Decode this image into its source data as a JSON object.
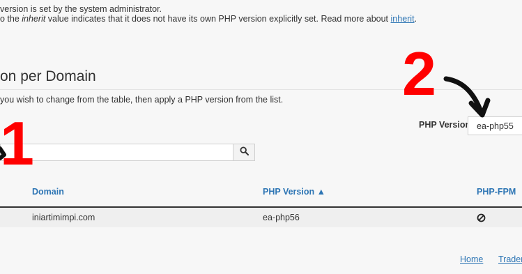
{
  "info": {
    "line1": "version is set by the system administrator.",
    "line2_prefix": "o the ",
    "line2_em": "inherit",
    "line2_middle": " value indicates that it does not have its own PHP version explicitly set. Read more about ",
    "line2_link": "inherit",
    "line2_suffix": "."
  },
  "section": {
    "title": "on per Domain",
    "description": "you wish to change from the table, then apply a PHP version from the list."
  },
  "search": {
    "placeholder": "",
    "value": "",
    "button_icon": "search-icon"
  },
  "php_version": {
    "label": "PHP Version",
    "selected": "ea-php55"
  },
  "table": {
    "columns": [
      "Domain",
      "PHP Version ▲",
      "PHP-FPM"
    ],
    "rows": [
      {
        "domain": "iniartimimpi.com",
        "php_version": "ea-php56",
        "php_fpm_icon": "disabled-icon"
      }
    ]
  },
  "annotations": {
    "marker_1": "1",
    "marker_2": "2",
    "marker_color": "#ff0000"
  },
  "footer": {
    "links": [
      "Home",
      "Trader"
    ]
  },
  "colors": {
    "link": "#2d75b4",
    "background": "#f7f7f7"
  }
}
